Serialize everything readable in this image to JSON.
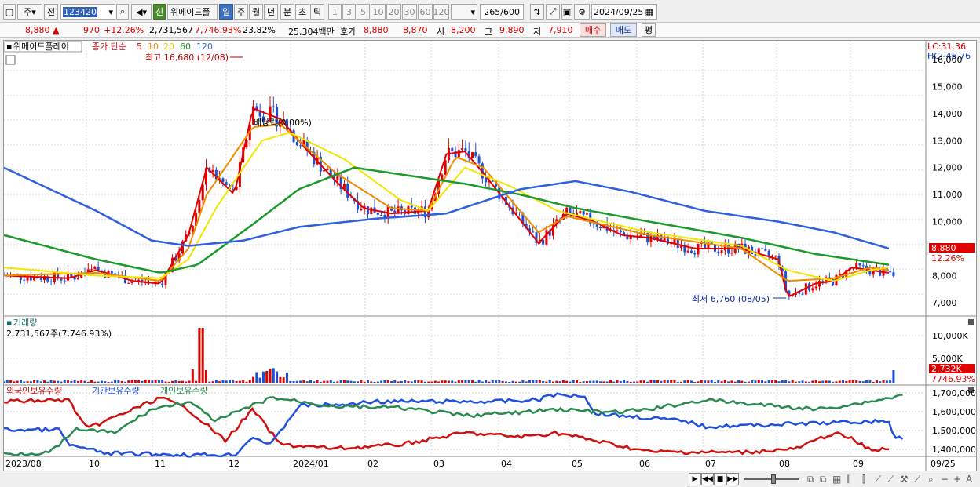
{
  "toolbar": {
    "market_label": "주",
    "prev_label": "전",
    "stock_code": "123420",
    "new_badge": "신",
    "stock_name": "위메이드플",
    "periods": [
      "일",
      "주",
      "월",
      "년",
      "분",
      "초",
      "틱"
    ],
    "intervals": [
      "1",
      "3",
      "5",
      "10",
      "20",
      "30",
      "60",
      "120"
    ],
    "count_text": "265/600",
    "date_text": "2024/09/25"
  },
  "quote": {
    "price": "8,880",
    "change_arrow": "▲",
    "change": "970",
    "change_pct": "+12.26%",
    "volume": "2,731,567",
    "volume_ratio": "7,746.93%",
    "turnover": "23.82%",
    "trade_value": "25,304백만",
    "bid_label": "호가",
    "ask_price": "8,880",
    "bid_price": "8,870",
    "open_label": "시",
    "open": "8,200",
    "high_label": "고",
    "high": "9,890",
    "low_label": "저",
    "low": "7,910",
    "buy_label": "매수",
    "sell_label": "매도",
    "avg_label": "평"
  },
  "price_panel": {
    "stock_name": "위메이드플레이",
    "ma_title": "종가 단순",
    "ma_periods": [
      "5",
      "10",
      "20",
      "60",
      "120"
    ],
    "high_note": "최고 16,680 (12/08)",
    "low_note": "최저 6,760 (08/05)",
    "dividend_note": "배당락(0.00%)",
    "lc": "LC:31.36",
    "hc": "HC:-46.76",
    "current_price_tag": "8,880",
    "current_pct_tag": "12.26%",
    "y_ticks": [
      "16,000",
      "15,000",
      "14,000",
      "13,000",
      "12,000",
      "11,000",
      "10,000",
      "9,000",
      "8,000",
      "7,000"
    ]
  },
  "volume_panel": {
    "title": "거래량",
    "value": "2,731,567주(7,746.93%)",
    "y_ticks": [
      "10,000K",
      "5,000K"
    ],
    "current_tag": "2,732K",
    "pct_tag": "7746.93%"
  },
  "holding_panel": {
    "series_labels": [
      "외국인보유수량",
      "기관보유수량",
      "개인보유수량"
    ],
    "y_ticks": [
      "1,700,000",
      "1,600,000",
      "1,500,000",
      "1,400,000"
    ]
  },
  "x_axis": {
    "labels": [
      "2023/08",
      "10",
      "11",
      "12",
      "2024/01",
      "02",
      "03",
      "04",
      "05",
      "06",
      "07",
      "08",
      "09",
      "09/25"
    ]
  },
  "colors": {
    "up": "#e00000",
    "down": "#1f4fd0",
    "ma5": "#e00000",
    "ma10": "#f08c00",
    "ma20": "#f2e600",
    "ma60": "#1a9a2a",
    "ma120": "#3060e0",
    "foreign": "#d01010",
    "institution": "#2050e0",
    "individual": "#2a8a50"
  },
  "chart_data": {
    "type": "candlestick",
    "title": "위메이드플레이",
    "ylim": [
      6500,
      16700
    ],
    "x_labels": [
      "2023/08",
      "10",
      "11",
      "12",
      "2024/01",
      "02",
      "03",
      "04",
      "05",
      "06",
      "07",
      "08",
      "09",
      "09/25"
    ],
    "series": [
      {
        "name": "5",
        "points": [
          [
            0,
            8000
          ],
          [
            0.07,
            7900
          ],
          [
            0.1,
            8200
          ],
          [
            0.14,
            7800
          ],
          [
            0.17,
            7700
          ],
          [
            0.2,
            9500
          ],
          [
            0.22,
            12000
          ],
          [
            0.25,
            11000
          ],
          [
            0.27,
            14200
          ],
          [
            0.3,
            13800
          ],
          [
            0.33,
            12600
          ],
          [
            0.36,
            11500
          ],
          [
            0.39,
            10500
          ],
          [
            0.42,
            10300
          ],
          [
            0.46,
            10400
          ],
          [
            0.48,
            12500
          ],
          [
            0.5,
            12600
          ],
          [
            0.52,
            11800
          ],
          [
            0.55,
            10500
          ],
          [
            0.58,
            9200
          ],
          [
            0.61,
            10300
          ],
          [
            0.64,
            10000
          ],
          [
            0.67,
            9500
          ],
          [
            0.7,
            9400
          ],
          [
            0.75,
            9000
          ],
          [
            0.8,
            9000
          ],
          [
            0.84,
            8600
          ],
          [
            0.85,
            7200
          ],
          [
            0.88,
            7700
          ],
          [
            0.9,
            7800
          ],
          [
            0.92,
            8300
          ],
          [
            0.94,
            8200
          ],
          [
            0.96,
            8100
          ]
        ]
      },
      {
        "name": "10",
        "points": [
          [
            0,
            8000
          ],
          [
            0.1,
            8100
          ],
          [
            0.17,
            7800
          ],
          [
            0.2,
            9000
          ],
          [
            0.22,
            11000
          ],
          [
            0.27,
            13500
          ],
          [
            0.3,
            13600
          ],
          [
            0.36,
            11800
          ],
          [
            0.42,
            10500
          ],
          [
            0.46,
            10400
          ],
          [
            0.49,
            12400
          ],
          [
            0.52,
            12000
          ],
          [
            0.58,
            9600
          ],
          [
            0.61,
            10200
          ],
          [
            0.7,
            9500
          ],
          [
            0.8,
            9000
          ],
          [
            0.85,
            7800
          ],
          [
            0.9,
            7900
          ],
          [
            0.94,
            8300
          ],
          [
            0.96,
            8200
          ]
        ]
      },
      {
        "name": "20",
        "points": [
          [
            0,
            8300
          ],
          [
            0.1,
            8000
          ],
          [
            0.17,
            7900
          ],
          [
            0.2,
            8600
          ],
          [
            0.23,
            10500
          ],
          [
            0.28,
            13000
          ],
          [
            0.31,
            13300
          ],
          [
            0.37,
            12300
          ],
          [
            0.43,
            10800
          ],
          [
            0.46,
            10400
          ],
          [
            0.5,
            12000
          ],
          [
            0.55,
            11300
          ],
          [
            0.6,
            10400
          ],
          [
            0.7,
            9600
          ],
          [
            0.8,
            9100
          ],
          [
            0.85,
            8200
          ],
          [
            0.9,
            7800
          ],
          [
            0.94,
            8200
          ],
          [
            0.96,
            8300
          ]
        ]
      },
      {
        "name": "60",
        "points": [
          [
            0,
            9500
          ],
          [
            0.1,
            8600
          ],
          [
            0.17,
            8100
          ],
          [
            0.21,
            8400
          ],
          [
            0.27,
            9900
          ],
          [
            0.32,
            11200
          ],
          [
            0.38,
            12000
          ],
          [
            0.44,
            11700
          ],
          [
            0.5,
            11400
          ],
          [
            0.56,
            11000
          ],
          [
            0.62,
            10500
          ],
          [
            0.7,
            10000
          ],
          [
            0.8,
            9400
          ],
          [
            0.88,
            8800
          ],
          [
            0.94,
            8500
          ],
          [
            0.96,
            8400
          ]
        ]
      },
      {
        "name": "120",
        "points": [
          [
            0,
            12000
          ],
          [
            0.1,
            10400
          ],
          [
            0.16,
            9300
          ],
          [
            0.2,
            9100
          ],
          [
            0.26,
            9300
          ],
          [
            0.32,
            9800
          ],
          [
            0.4,
            10100
          ],
          [
            0.48,
            10300
          ],
          [
            0.56,
            11200
          ],
          [
            0.62,
            11500
          ],
          [
            0.68,
            11100
          ],
          [
            0.76,
            10400
          ],
          [
            0.84,
            10000
          ],
          [
            0.9,
            9600
          ],
          [
            0.96,
            9000
          ]
        ]
      }
    ]
  }
}
